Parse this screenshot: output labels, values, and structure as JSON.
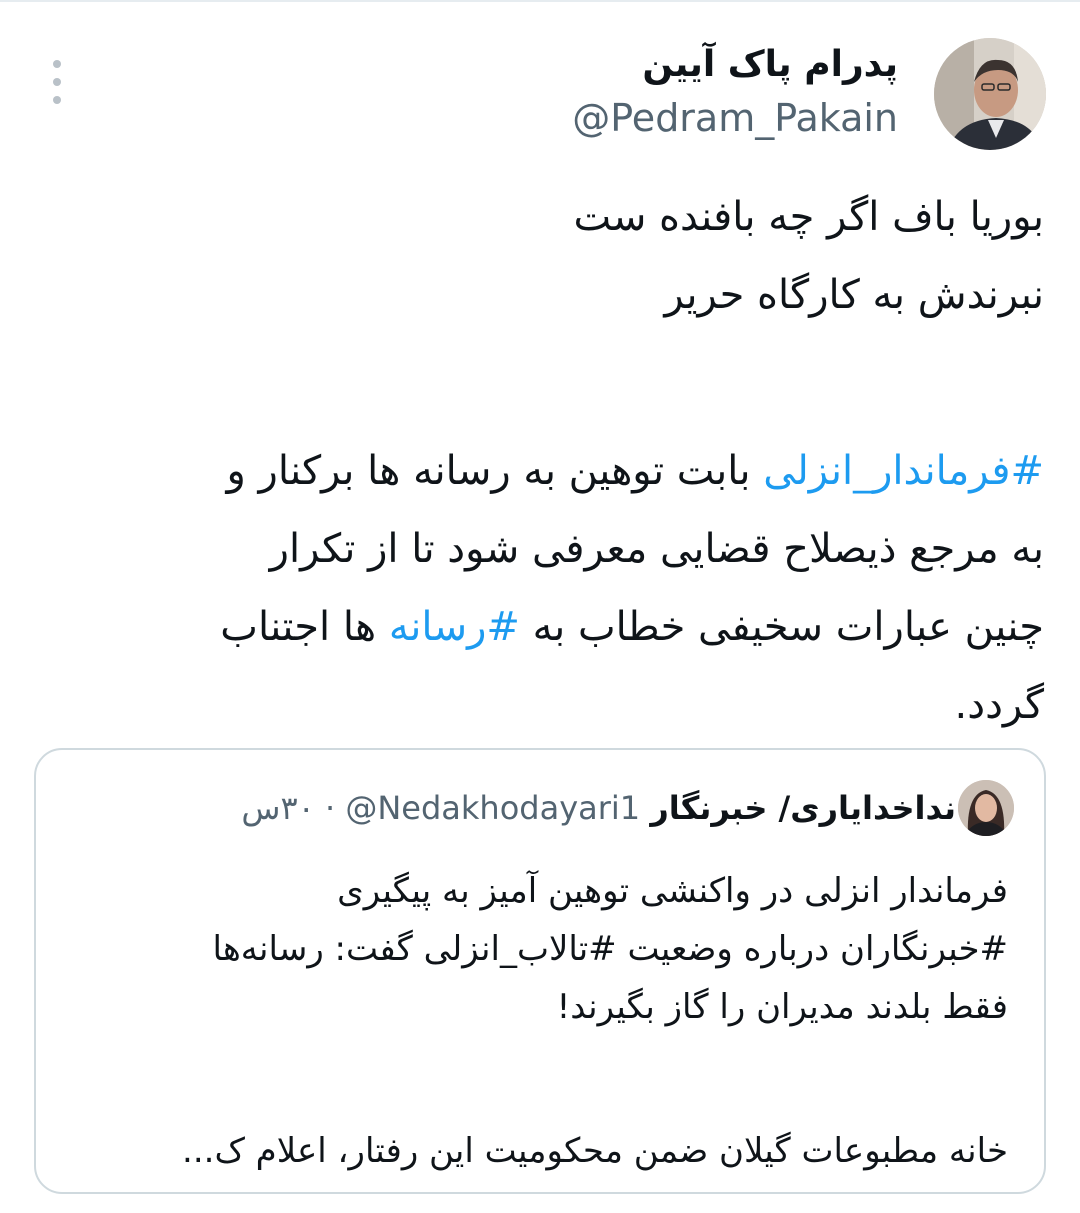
{
  "author": {
    "display_name": "پدرام پاک آیین",
    "handle": "@Pedram_Pakain"
  },
  "tweet": {
    "verse_line_1": "بوریا باف اگر چه بافنده ست",
    "verse_line_2": "نبرندش به  کارگاه حریر",
    "line_3_hashtag": "#فرماندار_انزلی",
    "line_3_rest": " بابت توهین به رسانه ها برکنار و",
    "line_4": "به مرجع ذیصلاح قضایی معرفی شود تا از تکرار",
    "line_5_start": "چنین عبارات سخیفی خطاب به ",
    "line_5_hashtag": "#رسانه",
    "line_5_end": " ها اجتناب",
    "line_6": "گردد."
  },
  "quoted_tweet": {
    "display_name": "نداخدایاری/ خبرنگار",
    "handle": "@Nedakhodayari1",
    "separator": "·",
    "time": "۳۰س",
    "line_1": "فرماندار انزلی در واکنشی توهین آمیز به پیگیری",
    "line_2": "#خبرنگاران درباره وضعیت #تالاب_انزلی گفت: رسانه‌ها",
    "line_3": "فقط بلدند مدیران را گاز بگیرند!",
    "line_4": "خانه مطبوعات گیلان ضمن محکومیت این رفتار، اعلام ک..."
  },
  "colors": {
    "link": "#1d9bf0",
    "secondary_text": "#536471",
    "border": "#cfd9de"
  },
  "icons": {
    "more": "vertical-ellipsis-icon"
  }
}
